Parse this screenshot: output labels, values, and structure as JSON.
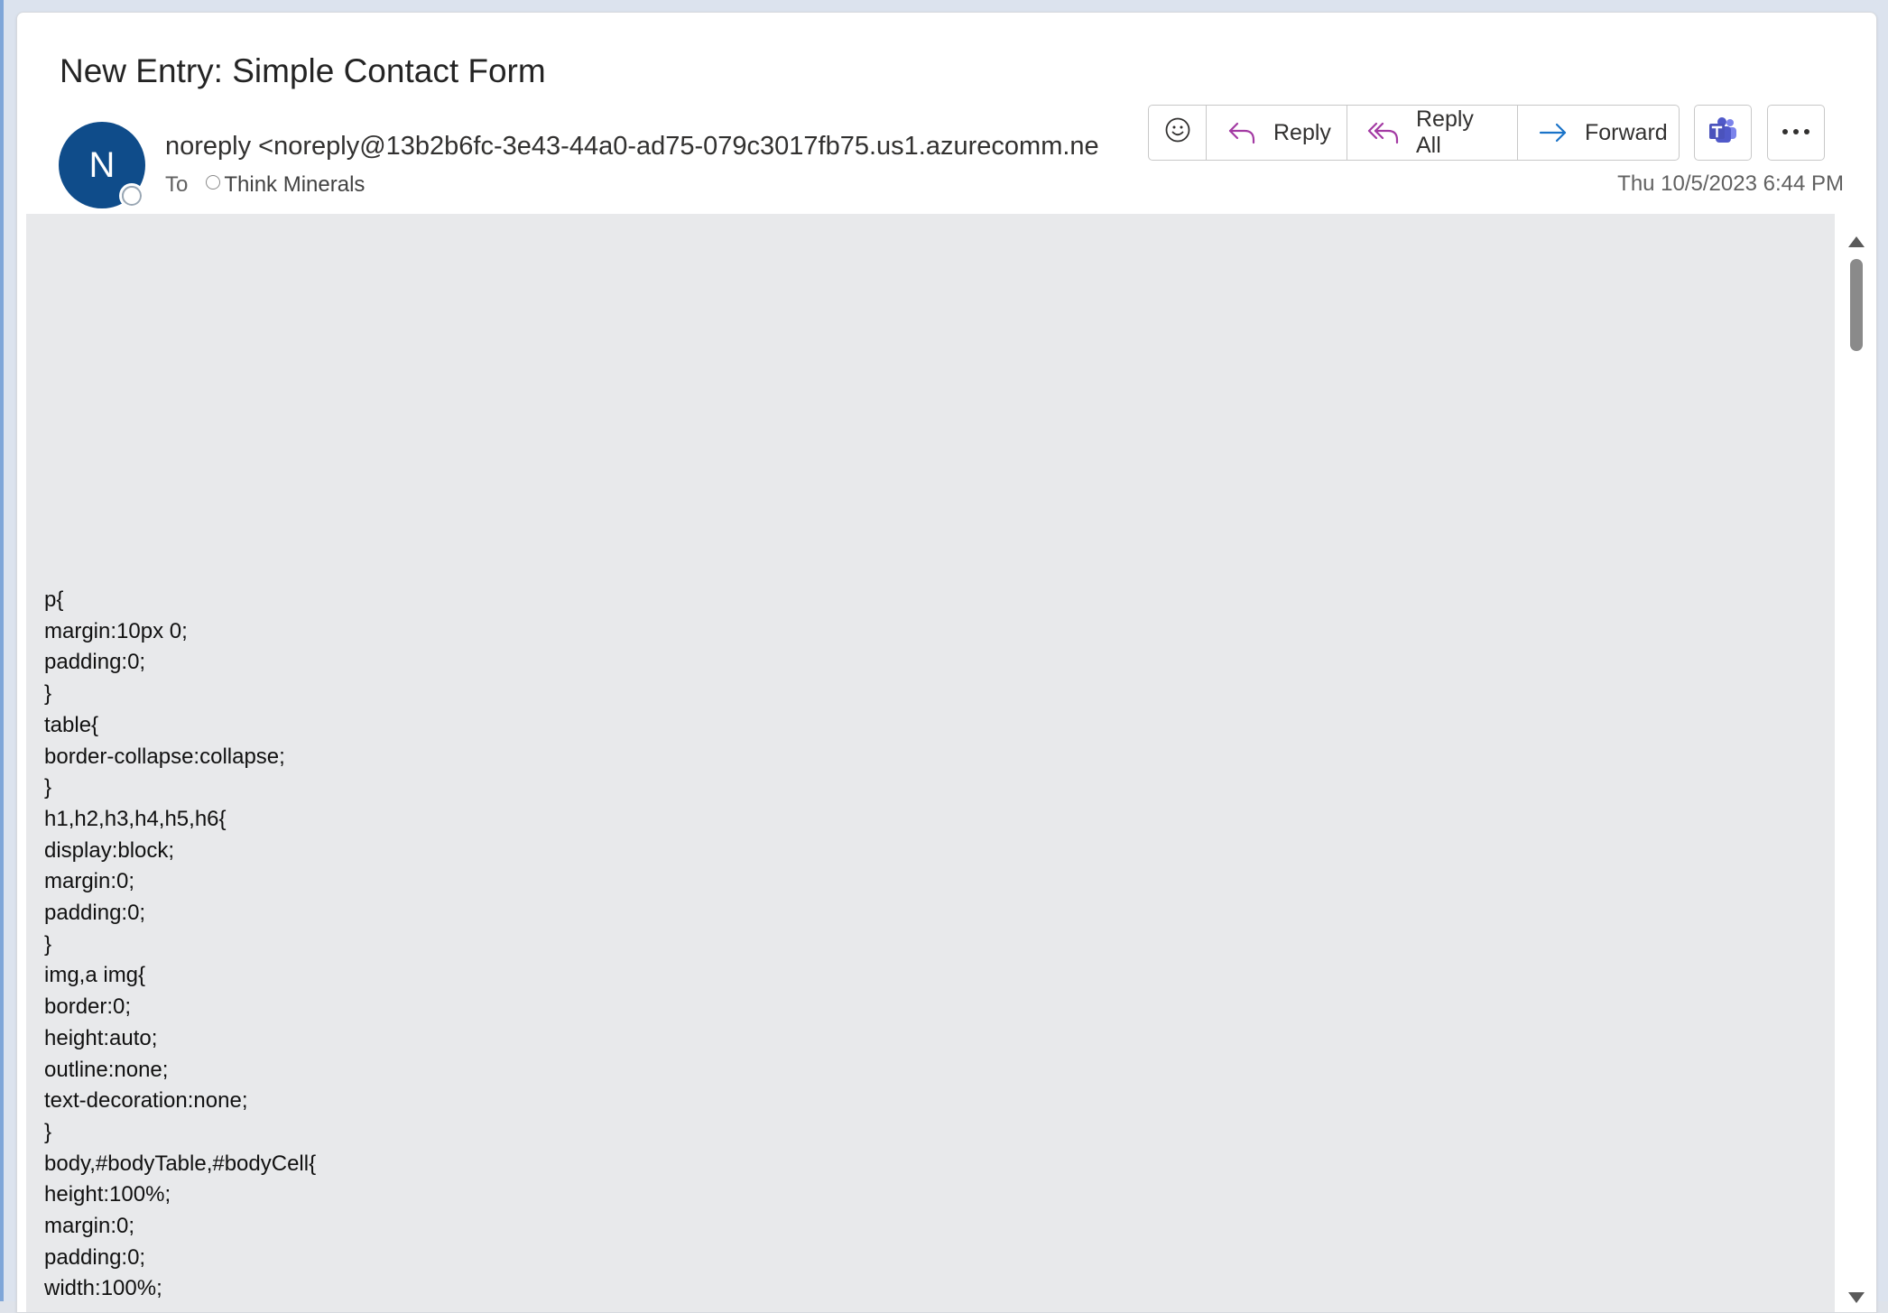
{
  "message": {
    "subject": "New Entry: Simple Contact Form",
    "avatar_initial": "N",
    "sender": "noreply <noreply@13b2b6fc-3e43-44a0-ad75-079c3017fb75.us1.azurecomm.ne",
    "to_label": "To",
    "recipient": "Think Minerals",
    "timestamp": "Thu 10/5/2023 6:44 PM"
  },
  "actions": {
    "emoji_icon": "smiley-icon",
    "reply_label": "Reply",
    "reply_all_label": "Reply All",
    "forward_label": "Forward",
    "teams_icon": "teams-icon",
    "more_icon": "more-ellipsis-icon"
  },
  "colors": {
    "avatar_bg": "#0f4c8a",
    "reply_icon": "#a33aa3",
    "forward_icon": "#1a73c8",
    "teams_icon": "#5059c9",
    "body_bg": "#e8e9eb"
  },
  "body_lines": [
    "p{",
    "margin:10px 0;",
    "padding:0;",
    "}",
    "table{",
    "border-collapse:collapse;",
    "}",
    "h1,h2,h3,h4,h5,h6{",
    "display:block;",
    "margin:0;",
    "padding:0;",
    "}",
    "img,a img{",
    "border:0;",
    "height:auto;",
    "outline:none;",
    "text-decoration:none;",
    "}",
    "body,#bodyTable,#bodyCell{",
    "height:100%;",
    "margin:0;",
    "padding:0;",
    "width:100%;"
  ]
}
